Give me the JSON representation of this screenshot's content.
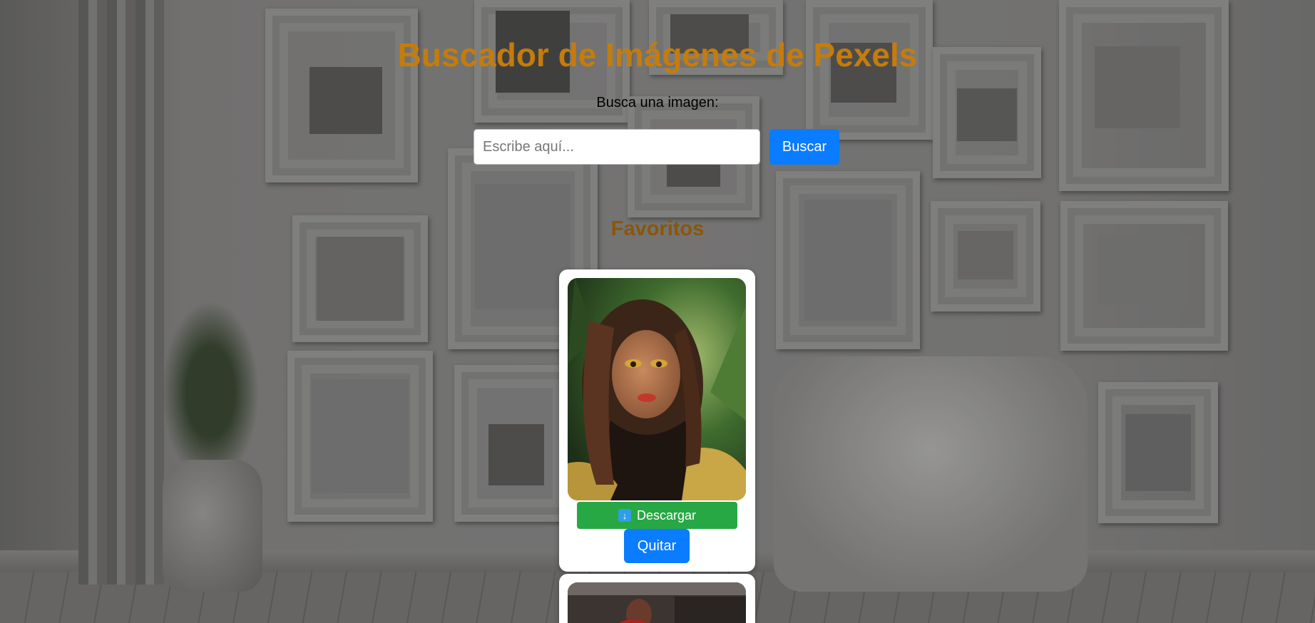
{
  "header": {
    "title": "Buscador de Imágenes de Pexels",
    "colors": {
      "title": "#c57c0b",
      "favorites_heading": "#8a560a"
    }
  },
  "search": {
    "label": "Busca una imagen:",
    "placeholder": "Escribe aquí...",
    "value": "",
    "button_label": "Buscar"
  },
  "favorites": {
    "heading": "Favoritos",
    "cards": [
      {
        "download_label": "Descargar",
        "download_icon": "download-arrow-icon",
        "remove_label": "Quitar"
      }
    ]
  },
  "colors": {
    "primary_button": "#0a7cff",
    "download_button": "#28a745"
  }
}
